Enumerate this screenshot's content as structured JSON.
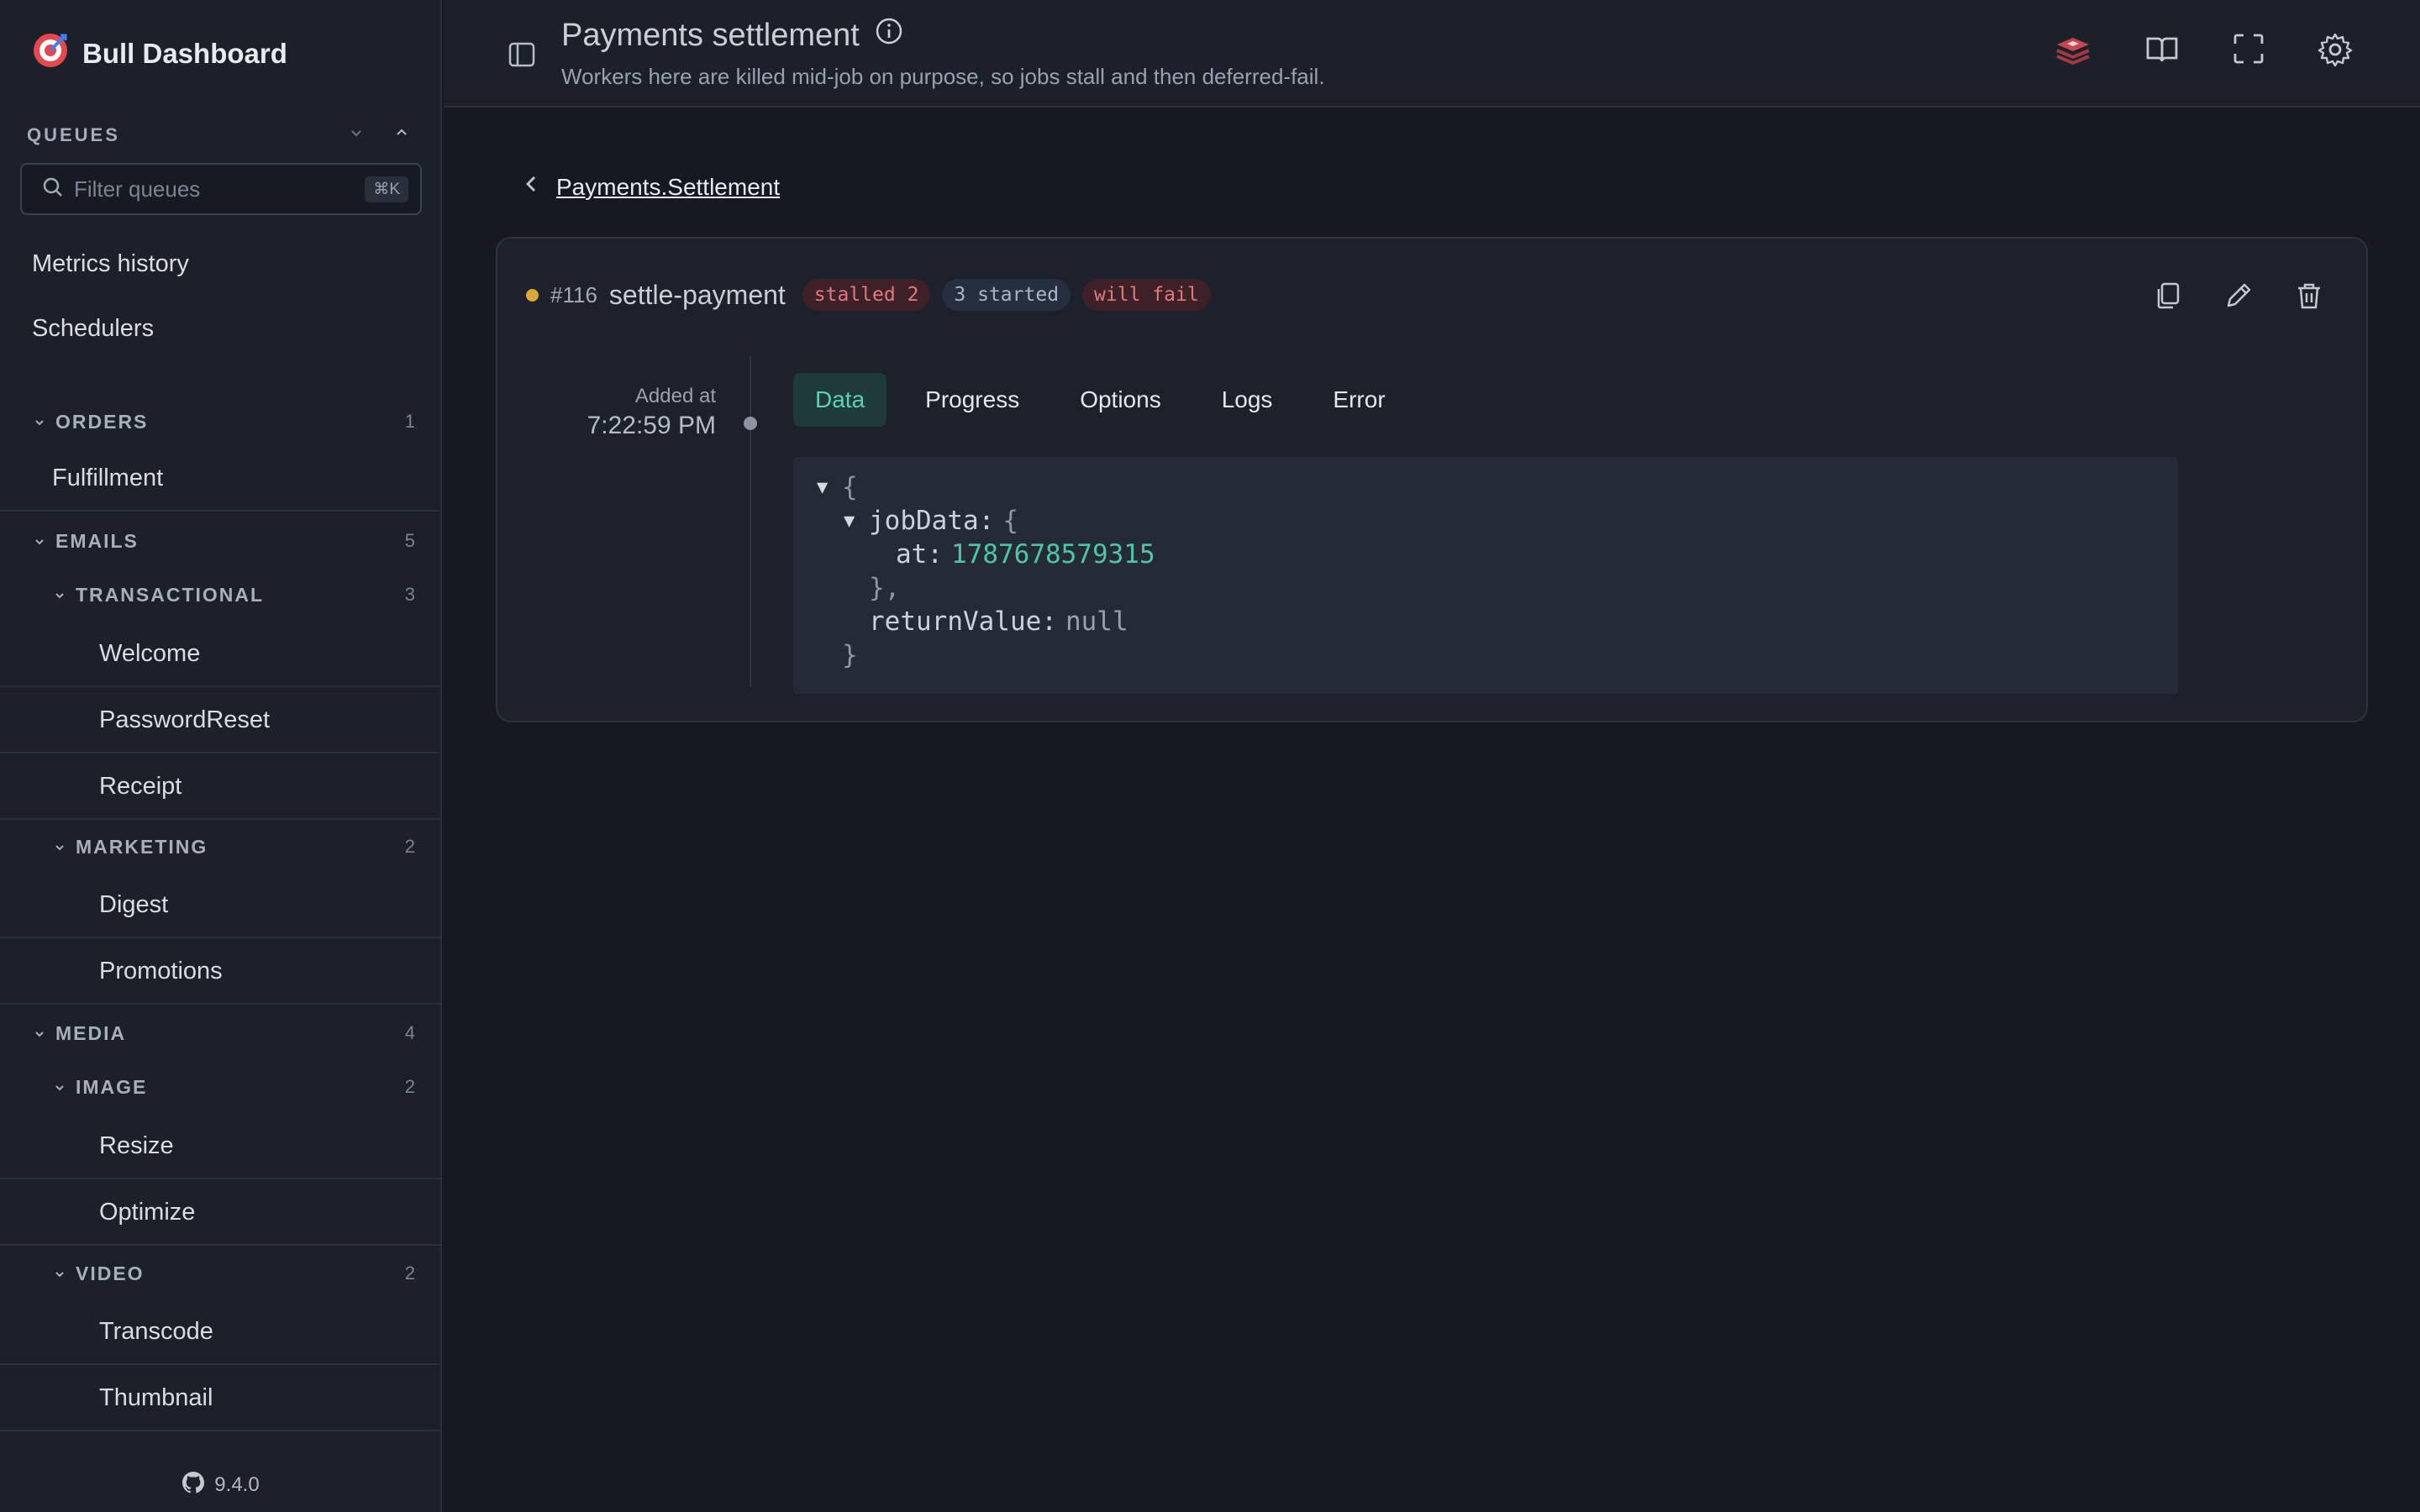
{
  "sidebar": {
    "app_name": "Bull Dashboard",
    "queues_label": "QUEUES",
    "filter_placeholder": "Filter queues",
    "filter_shortcut": "⌘K",
    "links": [
      "Metrics history",
      "Schedulers"
    ],
    "groups": {
      "orders": {
        "label": "ORDERS",
        "count": "1",
        "items": [
          "Fulfillment"
        ]
      },
      "emails": {
        "label": "EMAILS",
        "count": "5"
      },
      "transactional": {
        "label": "TRANSACTIONAL",
        "count": "3",
        "items": [
          "Welcome",
          "PasswordReset",
          "Receipt"
        ]
      },
      "marketing": {
        "label": "MARKETING",
        "count": "2",
        "items": [
          "Digest",
          "Promotions"
        ]
      },
      "media": {
        "label": "MEDIA",
        "count": "4"
      },
      "image": {
        "label": "IMAGE",
        "count": "2",
        "items": [
          "Resize",
          "Optimize"
        ]
      },
      "video": {
        "label": "VIDEO",
        "count": "2",
        "items": [
          "Transcode",
          "Thumbnail"
        ]
      }
    },
    "version": "9.4.0"
  },
  "header": {
    "title": "Payments settlement",
    "description": "Workers here are killed mid-job on purpose, so jobs stall and then deferred-fail."
  },
  "breadcrumb": {
    "queue": "Payments.Settlement"
  },
  "job": {
    "id": "#116",
    "name": "settle-payment",
    "status_color": "#d8a93a",
    "badges": [
      "stalled 2",
      "3 started",
      "will fail"
    ],
    "added_label": "Added at",
    "added_time": "7:22:59 PM",
    "tabs": [
      "Data",
      "Progress",
      "Options",
      "Logs",
      "Error"
    ],
    "active_tab": "Data",
    "data": {
      "open_brace": "{",
      "key_jobData": "jobData:",
      "inner_open": "{",
      "key_at": "at:",
      "value_at": "1787678579315",
      "inner_close": "},",
      "key_returnValue": "returnValue:",
      "value_returnValue": "null",
      "close_brace": "}"
    }
  },
  "colors": {
    "accent": "#5fd1b1",
    "danger": "#e07a7a",
    "warning": "#d8a93a"
  }
}
